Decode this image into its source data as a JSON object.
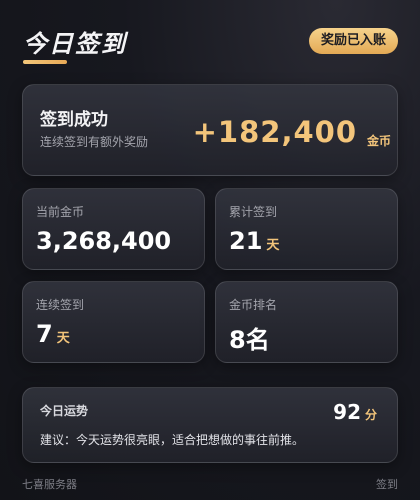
{
  "header": {
    "title": "今日签到",
    "badge": "奖励已入账"
  },
  "hero": {
    "title": "签到成功",
    "subtitle": "连续签到有额外奖励",
    "amount": "+182,400",
    "unit": "金币"
  },
  "stats": [
    {
      "label": "当前金币",
      "value": "3,268,400",
      "unit": ""
    },
    {
      "label": "累计签到",
      "value": "21",
      "unit": "天"
    },
    {
      "label": "连续签到",
      "value": "7",
      "unit": "天"
    },
    {
      "label": "金币排名",
      "value": "8名",
      "unit": ""
    }
  ],
  "fortune": {
    "title": "今日运势",
    "score": "92",
    "unit": "分",
    "text": "建议：今天运势很亮眼，适合把想做的事往前推。"
  },
  "footer": {
    "left": "七喜服务器",
    "right": "签到"
  },
  "colors": {
    "accent": "#f3c57b",
    "background": "#17181f"
  }
}
